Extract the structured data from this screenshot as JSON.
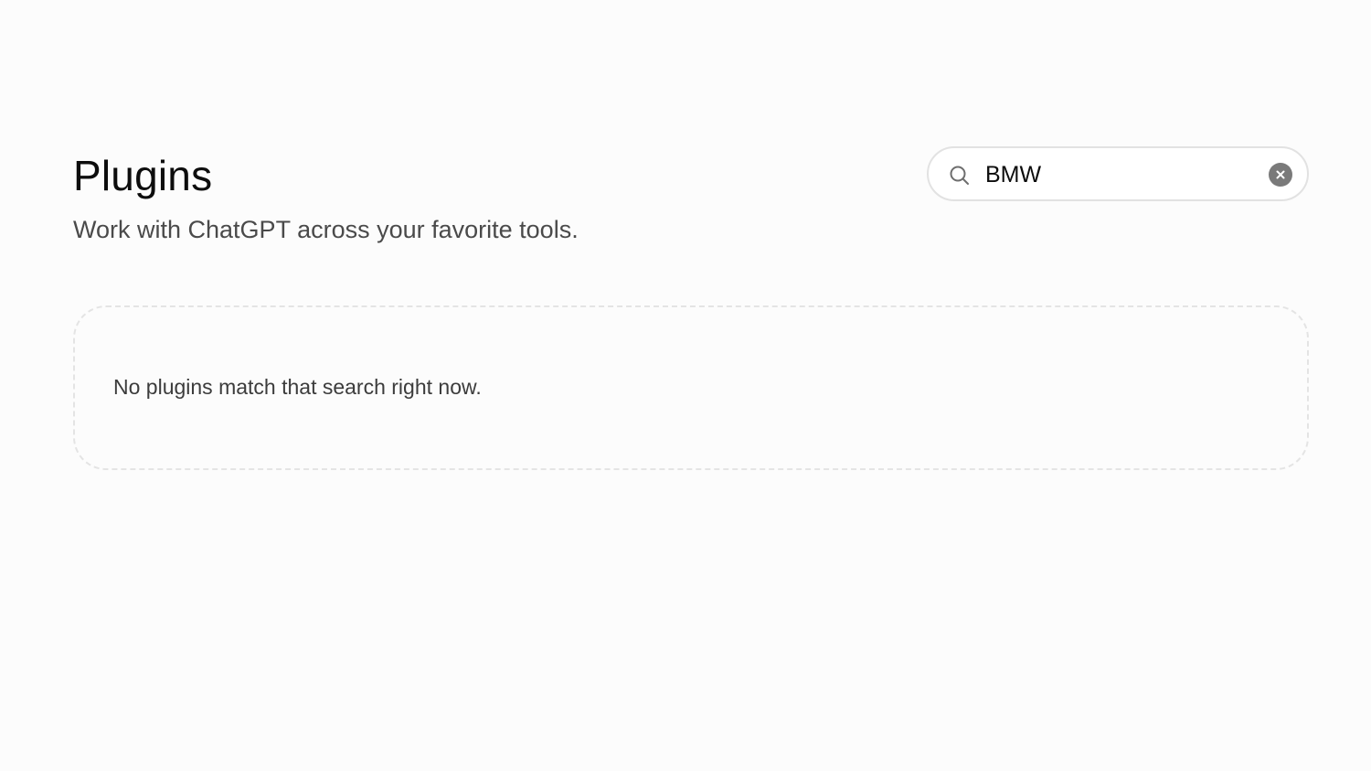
{
  "header": {
    "title": "Plugins",
    "subtitle": "Work with ChatGPT across your favorite tools."
  },
  "search": {
    "value": "BMW",
    "icon": "search-icon",
    "clear_icon": "close-icon"
  },
  "results": {
    "empty_message": "No plugins match that search right now."
  },
  "colors": {
    "background": "#fcfcfc",
    "text_primary": "#0d0d0d",
    "text_secondary": "#4a4a4a",
    "border": "#e2e2e2",
    "clear_button": "#7a7a7a"
  }
}
